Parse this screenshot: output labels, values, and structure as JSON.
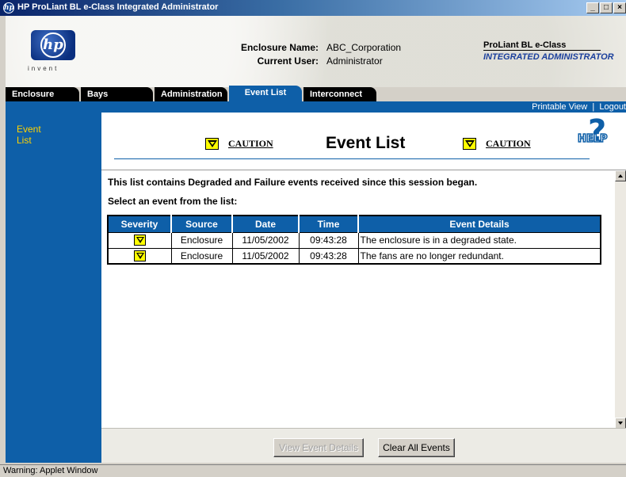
{
  "window": {
    "title": "HP ProLiant BL e-Class Integrated Administrator",
    "controls": {
      "minimize": "_",
      "maximize": "□",
      "close": "×"
    }
  },
  "header": {
    "logo_text": "hp",
    "logo_tagline": "invent",
    "enclosure_name_label": "Enclosure Name:",
    "enclosure_name_value": "ABC_Corporation",
    "current_user_label": "Current User:",
    "current_user_value": "Administrator",
    "product_line1": "ProLiant BL e-Class",
    "product_line2": "INTEGRATED ADMINISTRATOR"
  },
  "tabs": [
    {
      "label": "Enclosure"
    },
    {
      "label": "Bays"
    },
    {
      "label": "Administration"
    },
    {
      "label": "Event List",
      "active": true
    },
    {
      "label": "Interconnect"
    }
  ],
  "toplinks": {
    "printable_view": "Printable View",
    "separator": "|",
    "logout": "Logout"
  },
  "sidebar": {
    "link": "Event List"
  },
  "page": {
    "caution_left": "CAUTION",
    "title": "Event List",
    "caution_right": "CAUTION",
    "help": "HELP",
    "intro": "This list contains Degraded and Failure events received since this session began.",
    "select_prompt": "Select an event from the list:"
  },
  "table": {
    "columns": [
      "Severity",
      "Source",
      "Date",
      "Time",
      "Event Details"
    ],
    "rows": [
      {
        "severity": "caution-icon",
        "source": "Enclosure",
        "date": "11/05/2002",
        "time": "09:43:28",
        "details": "The enclosure is in a degraded state."
      },
      {
        "severity": "caution-icon",
        "source": "Enclosure",
        "date": "11/05/2002",
        "time": "09:43:28",
        "details": "The fans are no longer redundant."
      }
    ]
  },
  "buttons": {
    "view_details": "View Event Details",
    "clear_all": "Clear All Events"
  },
  "status": "Warning: Applet Window",
  "colors": {
    "accent_blue": "#0e5fa8",
    "caution_yellow": "#ffff00",
    "sidebar_link": "#ffd200"
  }
}
